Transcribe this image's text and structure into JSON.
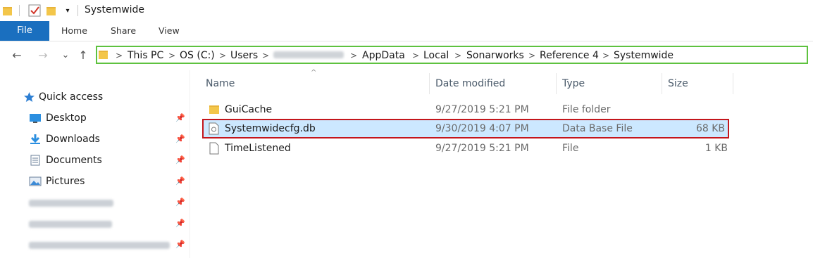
{
  "title_bar": {
    "title": "Systemwide",
    "qat_dropdown": "▾"
  },
  "ribbon": {
    "file_tab": "File",
    "tabs": [
      "Home",
      "Share",
      "View"
    ]
  },
  "nav": {
    "back": "←",
    "forward": "→",
    "recent": "⌄",
    "up": "↑"
  },
  "address_bar": {
    "crumbs": [
      "This PC",
      "OS (C:)",
      "Users",
      "AppData",
      "Local",
      "Sonarworks",
      "Reference 4",
      "Systemwide"
    ],
    "separator": ">"
  },
  "sidebar": {
    "quick_access": "Quick access",
    "items": [
      {
        "label": "Desktop",
        "icon": "desktop-icon"
      },
      {
        "label": "Downloads",
        "icon": "download-icon"
      },
      {
        "label": "Documents",
        "icon": "documents-icon"
      },
      {
        "label": "Pictures",
        "icon": "pictures-icon"
      }
    ]
  },
  "columns": {
    "name": "Name",
    "date": "Date modified",
    "type": "Type",
    "size": "Size"
  },
  "files": [
    {
      "name": "GuiCache",
      "date": "9/27/2019 5:21 PM",
      "type": "File folder",
      "size": "",
      "icon": "folder-icon"
    },
    {
      "name": "Systemwidecfg.db",
      "date": "9/30/2019 4:07 PM",
      "type": "Data Base File",
      "size": "68 KB",
      "icon": "db-file-icon",
      "selected": true
    },
    {
      "name": "TimeListened",
      "date": "9/27/2019 5:21 PM",
      "type": "File",
      "size": "1 KB",
      "icon": "file-icon"
    }
  ],
  "colors": {
    "file_tab": "#1a6fbf",
    "address_highlight": "#5ec23f",
    "row_highlight": "#c4161c",
    "selection": "#cce8ff",
    "folder": "#f3c64a"
  }
}
